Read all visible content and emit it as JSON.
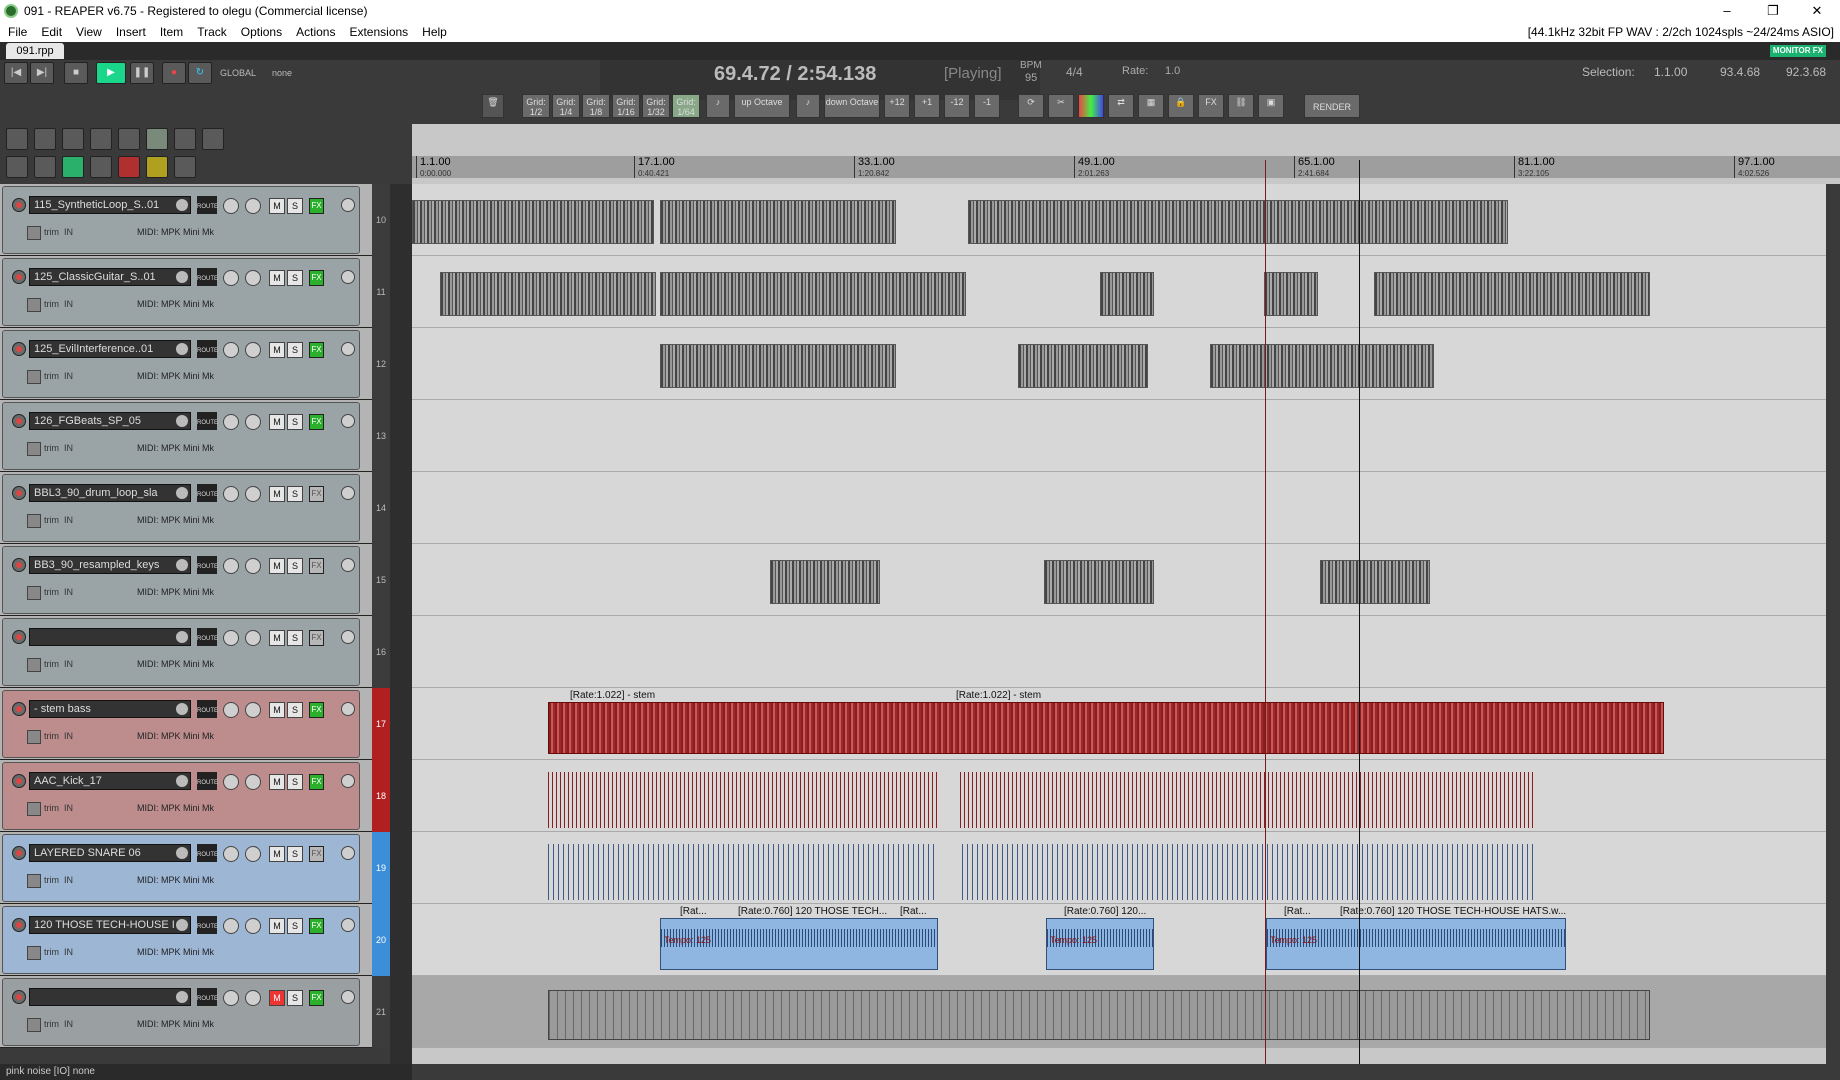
{
  "window": {
    "title": "091 - REAPER v6.75 - Registered to olegu (Commercial license)",
    "controls": [
      "–",
      "❐",
      "✕"
    ]
  },
  "menu": [
    "File",
    "Edit",
    "View",
    "Insert",
    "Item",
    "Track",
    "Options",
    "Actions",
    "Extensions",
    "Help"
  ],
  "audio_info": "[44.1kHz 32bit FP WAV : 2/2ch 1024spls ~24/24ms ASIO]",
  "project_tab": "091.rpp",
  "monitor_fx": "MONITOR FX",
  "transport": {
    "global_label": "GLOBAL",
    "global_value": "none",
    "position": "69.4.72 / 2:54.138",
    "state": "[Playing]",
    "bpm_label": "BPM",
    "bpm": "95",
    "time_sig": "4/4",
    "rate_label": "Rate:",
    "rate": "1.0",
    "selection_label": "Selection:",
    "selection_start": "1.1.00",
    "selection_end": "93.4.68",
    "selection_len": "92.3.68"
  },
  "grid_buttons": [
    "Grid: 1/2",
    "Grid: 1/4",
    "Grid: 1/8",
    "Grid: 1/16",
    "Grid: 1/32",
    "Grid: 1/64"
  ],
  "pitch_buttons": [
    "up Octave",
    "down Octave",
    "+12",
    "+1",
    "-12",
    "-1"
  ],
  "fx_label": "FX",
  "render_label": "RENDER",
  "ruler": [
    {
      "bar": "1.1.00",
      "time": "0:00.000"
    },
    {
      "bar": "17.1.00",
      "time": "0:40.421"
    },
    {
      "bar": "33.1.00",
      "time": "1:20.842"
    },
    {
      "bar": "49.1.00",
      "time": "2:01.263"
    },
    {
      "bar": "65.1.00",
      "time": "2:41.684"
    },
    {
      "bar": "81.1.00",
      "time": "3:22.105"
    },
    {
      "bar": "97.1.00",
      "time": "4:02.526"
    }
  ],
  "track_common": {
    "trim": "trim",
    "in": "IN",
    "midi": "MIDI: MPK Mini Mk",
    "route": "ROUTE",
    "m": "M",
    "s": "S",
    "fx": "FX"
  },
  "tracks": [
    {
      "num": "10",
      "name": "115_SyntheticLoop_S..01",
      "color": "default"
    },
    {
      "num": "11",
      "name": "125_ClassicGuitar_S..01",
      "color": "default"
    },
    {
      "num": "12",
      "name": "125_EvilInterference..01",
      "color": "default"
    },
    {
      "num": "13",
      "name": "126_FGBeats_SP_05",
      "color": "default"
    },
    {
      "num": "14",
      "name": "BBL3_90_drum_loop_sla",
      "color": "default"
    },
    {
      "num": "15",
      "name": "BB3_90_resampled_keys",
      "color": "default"
    },
    {
      "num": "16",
      "name": "",
      "color": "default"
    },
    {
      "num": "17",
      "name": "- stem bass",
      "color": "red"
    },
    {
      "num": "18",
      "name": "AAC_Kick_17",
      "color": "red"
    },
    {
      "num": "19",
      "name": "LAYERED SNARE 06",
      "color": "blue"
    },
    {
      "num": "20",
      "name": "120 THOSE TECH-HOUSE I",
      "color": "blue"
    },
    {
      "num": "21",
      "name": "",
      "color": "dark"
    }
  ],
  "item_labels": {
    "stem1": "[Rate:1.022] - stem",
    "stem2": "[Rate:1.022] - stem",
    "hats1": "[Rat...",
    "hats2": "[Rate:0.760] 120 THOSE TECH...",
    "hats3": "[Rat...",
    "hats4": "[Rate:0.760] 120...",
    "hats5": "[Rat...",
    "hats6": "[Rate:0.760] 120 THOSE TECH-HOUSE HATS.w...",
    "tempo": "Tempo: 125"
  },
  "status": "pink noise [IO] none"
}
